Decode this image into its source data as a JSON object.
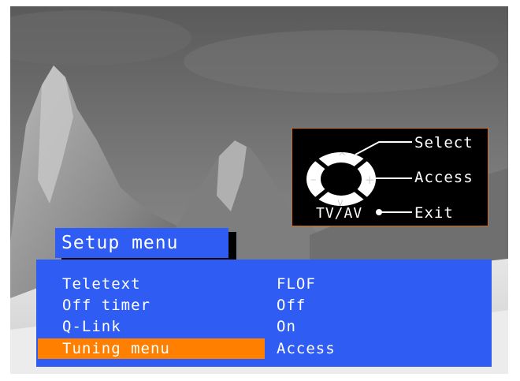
{
  "hint": {
    "select_label": "Select",
    "access_label": "Access",
    "exit_label": "Exit",
    "tvav_label": "TV/AV"
  },
  "menu": {
    "title": "Setup menu",
    "items": [
      {
        "label": "Teletext",
        "value": "FLOF",
        "selected": false
      },
      {
        "label": "Off timer",
        "value": "Off",
        "selected": false
      },
      {
        "label": "Q-Link",
        "value": "On",
        "selected": false
      },
      {
        "label": "Tuning menu",
        "value": "Access",
        "selected": true
      }
    ]
  },
  "colors": {
    "menu_blue": "#2f5cf2",
    "highlight_orange": "#ff7f00",
    "hint_border": "#c86a1e"
  }
}
